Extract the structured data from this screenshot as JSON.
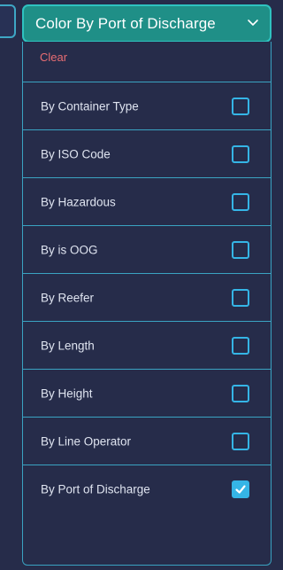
{
  "dropdown": {
    "label": "Color By Port of Discharge",
    "icon": "chevron-down-icon"
  },
  "menu": {
    "clear_label": "Clear",
    "items": [
      {
        "label": "By Container Type",
        "checked": false
      },
      {
        "label": "By ISO Code",
        "checked": false
      },
      {
        "label": "By Hazardous",
        "checked": false
      },
      {
        "label": "By is OOG",
        "checked": false
      },
      {
        "label": "By Reefer",
        "checked": false
      },
      {
        "label": "By Length",
        "checked": false
      },
      {
        "label": "By Height",
        "checked": false
      },
      {
        "label": "By Line Operator",
        "checked": false
      },
      {
        "label": "By Port of Discharge",
        "checked": true
      }
    ]
  },
  "colors": {
    "background": "#262c4a",
    "button_fill": "#1f8f87",
    "button_border": "#2fc2c0",
    "divider": "#3aa3c2",
    "checkbox": "#35b5e6",
    "clear_text": "#e86d73"
  }
}
